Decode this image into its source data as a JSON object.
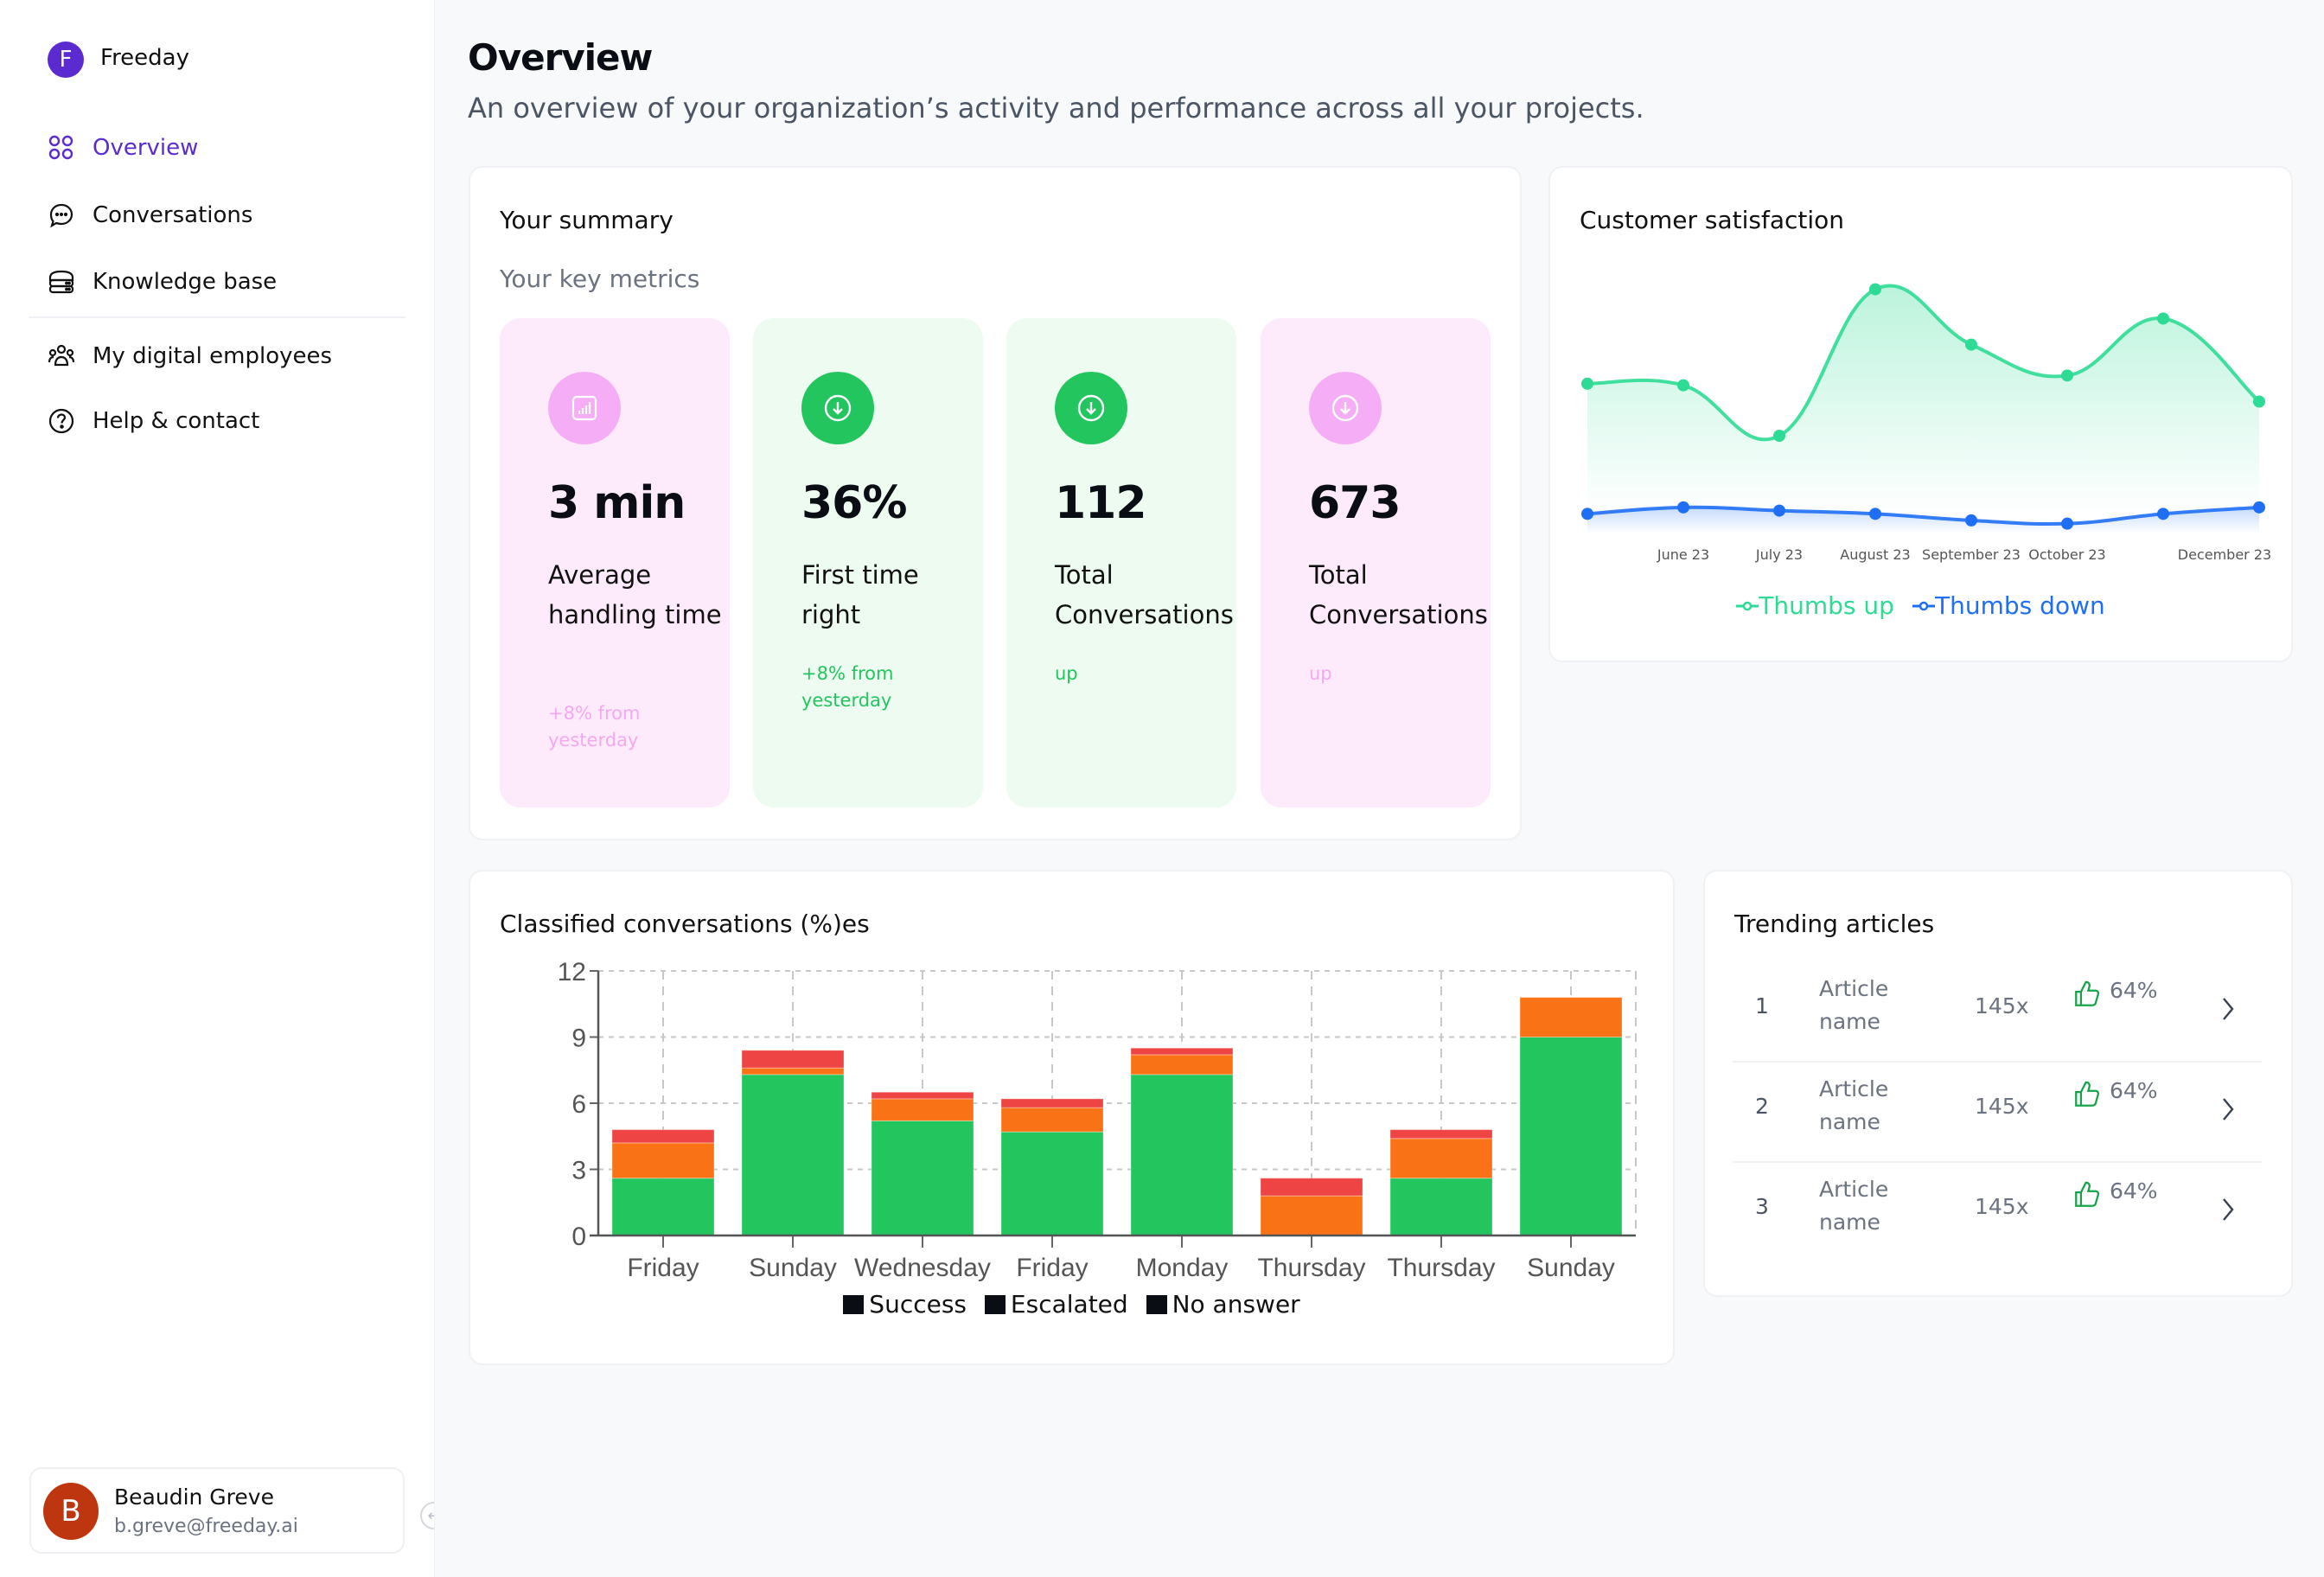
{
  "brand": {
    "initial": "F",
    "name": "Freeday",
    "color": "#5b2bd0"
  },
  "sidebar": {
    "items": [
      {
        "label": "Overview",
        "icon": "grid-icon",
        "active": true
      },
      {
        "label": "Conversations",
        "icon": "chat-bubble-icon",
        "active": false
      },
      {
        "label": "Knowledge base",
        "icon": "database-icon",
        "active": false
      },
      {
        "label": "My digital employees",
        "icon": "users-icon",
        "active": false
      },
      {
        "label": "Help & contact",
        "icon": "help-circle-icon",
        "active": false
      }
    ],
    "user": {
      "initial": "B",
      "name": "Beaudin Greve",
      "email": "b.greve@freeday.ai"
    },
    "collapse_icon": "arrow-left-circle-icon"
  },
  "header": {
    "title": "Overview",
    "subtitle": "An overview of your organization’s activity and performance across all your projects."
  },
  "summary": {
    "title": "Your summary",
    "subtitle": "Your key metrics",
    "tiles": [
      {
        "value": "3 min",
        "label": "Average handling time",
        "change": "+8% from yesterday",
        "theme": "pink",
        "icon": "bar-chart-icon"
      },
      {
        "value": "36%",
        "label": "First time right",
        "change": "+8% from yesterday",
        "theme": "green",
        "icon": "arrow-down-circle-icon"
      },
      {
        "value": "112",
        "label": "Total Conversations",
        "change": "up",
        "theme": "green",
        "icon": "arrow-down-circle-icon"
      },
      {
        "value": "673",
        "label": "Total Conversations",
        "change": "up",
        "theme": "pink",
        "icon": "arrow-down-circle-icon"
      }
    ]
  },
  "satisfaction": {
    "title": "Customer satisfaction"
  },
  "classified": {
    "title": "Classified conversations (%)es"
  },
  "trending": {
    "title": "Trending articles",
    "rows": [
      {
        "rank": "1",
        "name": "Article name",
        "views": "145x",
        "rating": "64%"
      },
      {
        "rank": "2",
        "name": "Article name",
        "views": "145x",
        "rating": "64%"
      },
      {
        "rank": "3",
        "name": "Article name",
        "views": "145x",
        "rating": "64%"
      }
    ]
  },
  "chart_data": [
    {
      "type": "area",
      "title": "Customer satisfaction",
      "x": [
        "",
        "June 23",
        "July 23",
        "August 23",
        "September 23",
        "October 23",
        "",
        "December 23"
      ],
      "tick_labels": [
        "",
        "June 23",
        "July 23",
        "August 23",
        "September 23",
        "October 23",
        "",
        "December 23"
      ],
      "series": [
        {
          "name": "Thumbs up",
          "color": "#2ddb94",
          "values": [
            50,
            49.5,
            34,
            79,
            62,
            52.5,
            70,
            44.5
          ]
        },
        {
          "name": "Thumbs down",
          "color": "#1f6ff5",
          "values": [
            10,
            12,
            11,
            10,
            8,
            7,
            10,
            12
          ]
        }
      ],
      "ylim": [
        0,
        85
      ],
      "grid": false,
      "legend": "bottom-center"
    },
    {
      "type": "bar",
      "stacked": true,
      "title": "Classified conversations (%)es",
      "categories": [
        "Friday",
        "Sunday",
        "Wednesday",
        "Friday",
        "Monday",
        "Thursday",
        "Thursday",
        "Sunday"
      ],
      "series": [
        {
          "name": "Success",
          "color": "#22c55e",
          "values": [
            2.6,
            7.3,
            5.2,
            4.7,
            7.3,
            0,
            2.6,
            9.0
          ]
        },
        {
          "name": "Escalated",
          "color": "#f97316",
          "values": [
            1.6,
            0.3,
            1.0,
            1.1,
            0.9,
            1.8,
            1.8,
            1.8
          ]
        },
        {
          "name": "No answer",
          "color": "#ef4444",
          "values": [
            0.6,
            0.8,
            0.3,
            0.4,
            0.3,
            0.8,
            0.4,
            0
          ]
        }
      ],
      "yticks": [
        0,
        3,
        6,
        9,
        12
      ],
      "ylim": [
        0,
        12
      ],
      "xlabel": "",
      "ylabel": "",
      "grid": true,
      "legend": "bottom-center",
      "legend_swatch_color": "#0b0d14"
    }
  ]
}
